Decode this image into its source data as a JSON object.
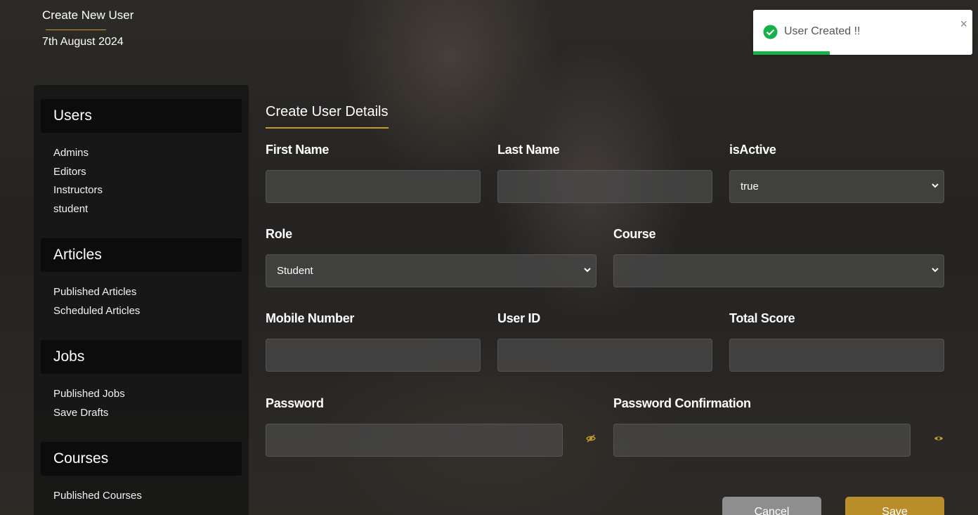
{
  "header": {
    "title": "Create New User",
    "date": "7th August 2024"
  },
  "sidebar": {
    "sections": [
      {
        "heading": "Users",
        "items": [
          "Admins",
          "Editors",
          "Instructors",
          "student"
        ]
      },
      {
        "heading": "Articles",
        "items": [
          "Published Articles",
          "Scheduled Articles"
        ]
      },
      {
        "heading": "Jobs",
        "items": [
          "Published Jobs",
          "Save Drafts"
        ]
      },
      {
        "heading": "Courses",
        "items": [
          "Published Courses"
        ]
      }
    ]
  },
  "form": {
    "title": "Create User Details",
    "first_name": {
      "label": "First Name",
      "value": ""
    },
    "last_name": {
      "label": "Last Name",
      "value": ""
    },
    "is_active": {
      "label": "isActive",
      "value": "true"
    },
    "role": {
      "label": "Role",
      "value": "Student"
    },
    "course": {
      "label": "Course",
      "value": ""
    },
    "mobile": {
      "label": "Mobile Number",
      "value": ""
    },
    "user_id": {
      "label": "User ID",
      "value": ""
    },
    "total_score": {
      "label": "Total Score",
      "value": ""
    },
    "password": {
      "label": "Password",
      "value": ""
    },
    "password_confirmation": {
      "label": "Password Confirmation",
      "value": ""
    },
    "cancel_label": "Cancel",
    "save_label": "Save"
  },
  "toast": {
    "message": "User Created !!",
    "close_glyph": "×",
    "progress": 0.35,
    "icon": "check-circle-icon",
    "color": "#17b04a"
  },
  "colors": {
    "accent": "#c49a2c",
    "save_button": "#b98e2a",
    "cancel_button": "#8e8e8e"
  }
}
